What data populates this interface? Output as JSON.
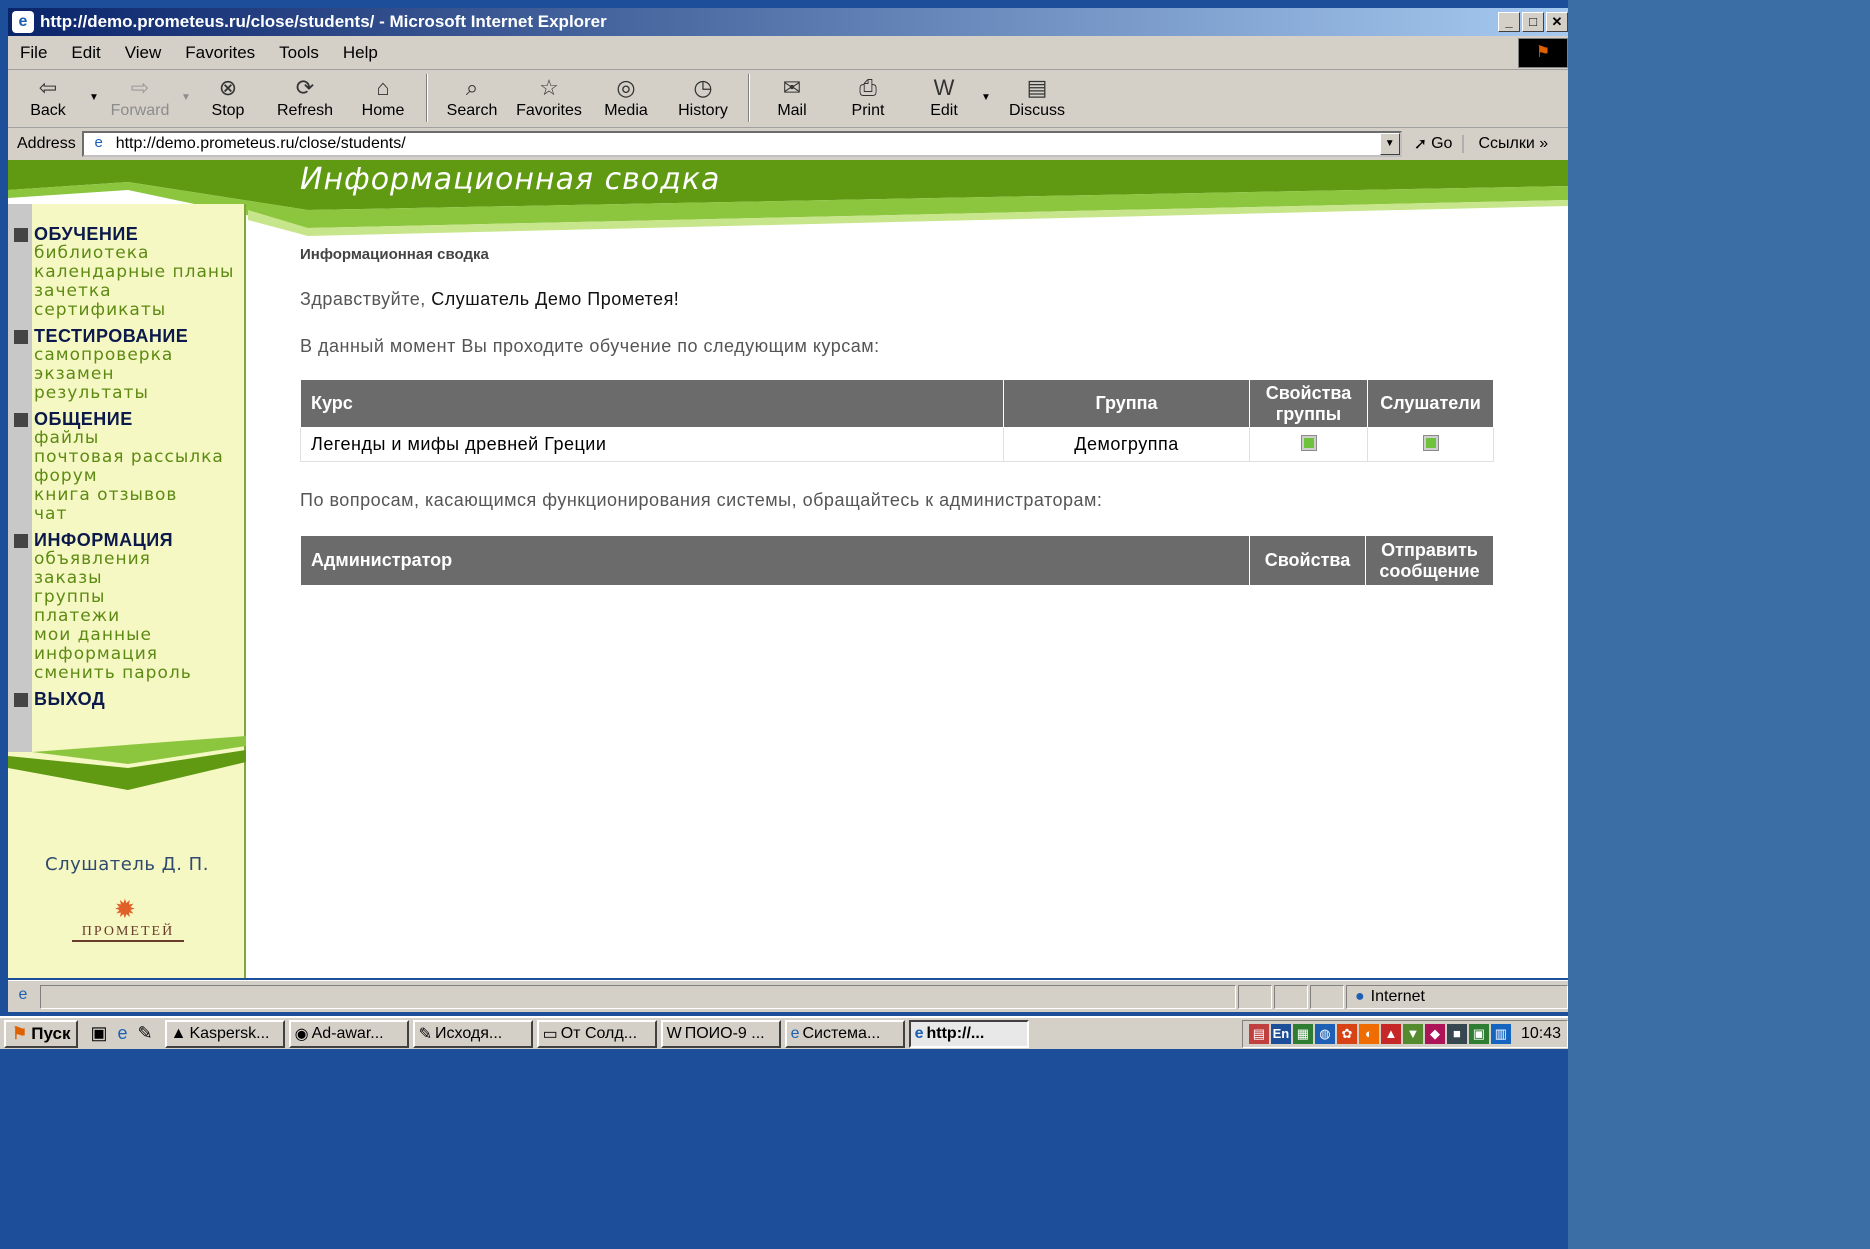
{
  "window": {
    "title": "http://demo.prometeus.ru/close/students/ - Microsoft Internet Explorer",
    "controls": [
      "_",
      "□",
      "✕"
    ]
  },
  "menu": [
    "File",
    "Edit",
    "View",
    "Favorites",
    "Tools",
    "Help"
  ],
  "toolbar": {
    "back": "Back",
    "forward": "Forward",
    "stop": "Stop",
    "refresh": "Refresh",
    "home": "Home",
    "search": "Search",
    "favorites": "Favorites",
    "media": "Media",
    "history": "History",
    "mail": "Mail",
    "print": "Print",
    "edit": "Edit",
    "discuss": "Discuss"
  },
  "address": {
    "label": "Address",
    "url": "http://demo.prometeus.ru/close/students/",
    "go": "Go",
    "links": "Ссылки »"
  },
  "page": {
    "banner_title": "Информационная сводка",
    "breadcrumb": "Информационная сводка",
    "greeting_prefix": "Здравствуйте, ",
    "greeting_name": "Слушатель Демо Прометея!",
    "courses_intro": "В данный момент Вы проходите обучение по следующим курсам:",
    "courses_table": {
      "headers": {
        "course": "Курс",
        "group": "Группа",
        "group_props": "Свойства группы",
        "listeners": "Слушатели"
      },
      "rows": [
        {
          "course": "Легенды и мифы древней Греции",
          "group": "Демогруппа"
        }
      ]
    },
    "admins_intro": "По вопросам, касающимся функционирования системы, обращайтесь к администраторам:",
    "admins_table": {
      "headers": {
        "admin": "Администратор",
        "props": "Свойства",
        "send": "Отправить сообщение"
      }
    }
  },
  "sidebar": {
    "sections": [
      {
        "title": "ОБУЧЕНИЕ",
        "links": [
          "библиотека",
          "календарные планы",
          "зачетка",
          "сертификаты"
        ]
      },
      {
        "title": "ТЕСТИРОВАНИЕ",
        "links": [
          "самопроверка",
          "экзамен",
          "результаты"
        ]
      },
      {
        "title": "ОБЩЕНИЕ",
        "links": [
          "файлы",
          "почтовая рассылка",
          "форум",
          "книга отзывов",
          "чат"
        ]
      },
      {
        "title": "ИНФОРМАЦИЯ",
        "links": [
          "объявления",
          "заказы",
          "группы",
          "платежи",
          "мои данные",
          "информация",
          "сменить пароль"
        ]
      },
      {
        "title": "ВЫХОД",
        "links": []
      }
    ],
    "user_name": "Слушатель Д. П.",
    "logo_text": "ПРОМЕТЕЙ"
  },
  "status": {
    "zone": "Internet"
  },
  "taskbar": {
    "start": "Пуск",
    "tasks": [
      "Kaspersk...",
      "Ad-awar...",
      "Исходя...",
      "От Солд...",
      "ПОИО-9 ...",
      "Система...",
      "http://..."
    ],
    "tray_lang": "En",
    "clock": "10:43"
  },
  "colors": {
    "banner_green": "#5f9a12",
    "sidebar_bg": "#f6f8c4",
    "link_green": "#5d8a12",
    "table_header": "#6b6b6b",
    "checkbox_green": "#6fc23c"
  }
}
